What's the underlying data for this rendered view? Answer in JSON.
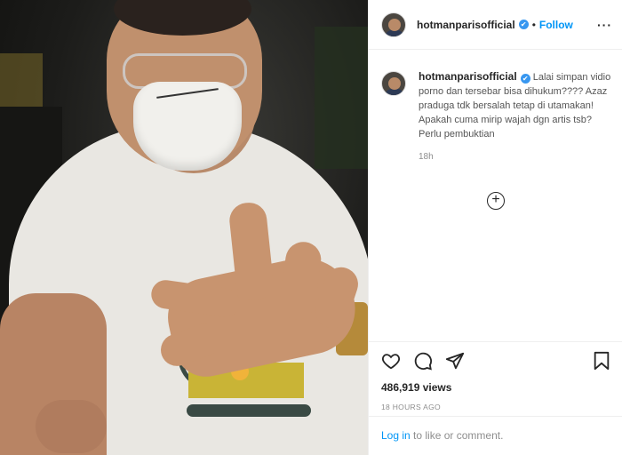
{
  "post": {
    "image_alt": "man wearing face mask holding up hand"
  },
  "header": {
    "username": "hotmanparisofficial",
    "verified_mark": "✔",
    "separator": "•",
    "follow_label": "Follow",
    "more_label": "···"
  },
  "comment": {
    "username": "hotmanparisofficial",
    "verified_mark": "✔",
    "text": "Lalai simpan vidio porno dan tersebar bisa dihukum???? Azaz praduga tdk bersalah tetap di utamakan! Apakah cuma mirip wajah dgn artis tsb? Perlu pembuktian",
    "time": "18h"
  },
  "load_more": {
    "icon": "plus-circle-icon",
    "symbol": "+"
  },
  "actions": {
    "like_icon": "heart-icon",
    "comment_icon": "comment-icon",
    "share_icon": "share-icon",
    "save_icon": "bookmark-icon",
    "views": "486,919 views",
    "posted_ago": "18 HOURS AGO"
  },
  "login": {
    "link_text": "Log in",
    "rest_text": " to like or comment."
  },
  "colors": {
    "accent": "#0095f6",
    "verified": "#3897f0",
    "muted": "#8e8e8e",
    "text": "#262626"
  }
}
